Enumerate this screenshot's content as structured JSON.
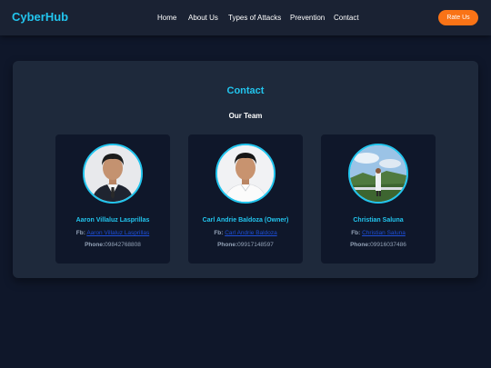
{
  "header": {
    "logo": "CyberHub",
    "nav": [
      "Home",
      "About Us",
      "Types of Attacks",
      "Prevention",
      "Contact"
    ],
    "rate_button": "Rate Us"
  },
  "contact": {
    "title": "Contact",
    "team_heading": "Our Team",
    "members": [
      {
        "name": "Aaron Villaluz Lasprillas",
        "fb_label": "Fb:",
        "fb_link": "Aaron Villaluz Lasprillas",
        "phone_label": "Phone:",
        "phone": "09842768808"
      },
      {
        "name": "Carl Andrie Baldoza (Owner)",
        "fb_label": "Fb:",
        "fb_link": "Carl Andrie Baldoza",
        "phone_label": "Phone:",
        "phone": "09917148597"
      },
      {
        "name": "Christian Saluna",
        "fb_label": "Fb:",
        "fb_link": "Christian Saluna",
        "phone_label": "Phone:",
        "phone": "09916037486"
      }
    ]
  },
  "colors": {
    "background": "#0f172a",
    "navbar": "#1a2233",
    "accent": "#22c5ee",
    "button": "#f97316",
    "card": "#1e293b",
    "link": "#1d4ed8"
  }
}
